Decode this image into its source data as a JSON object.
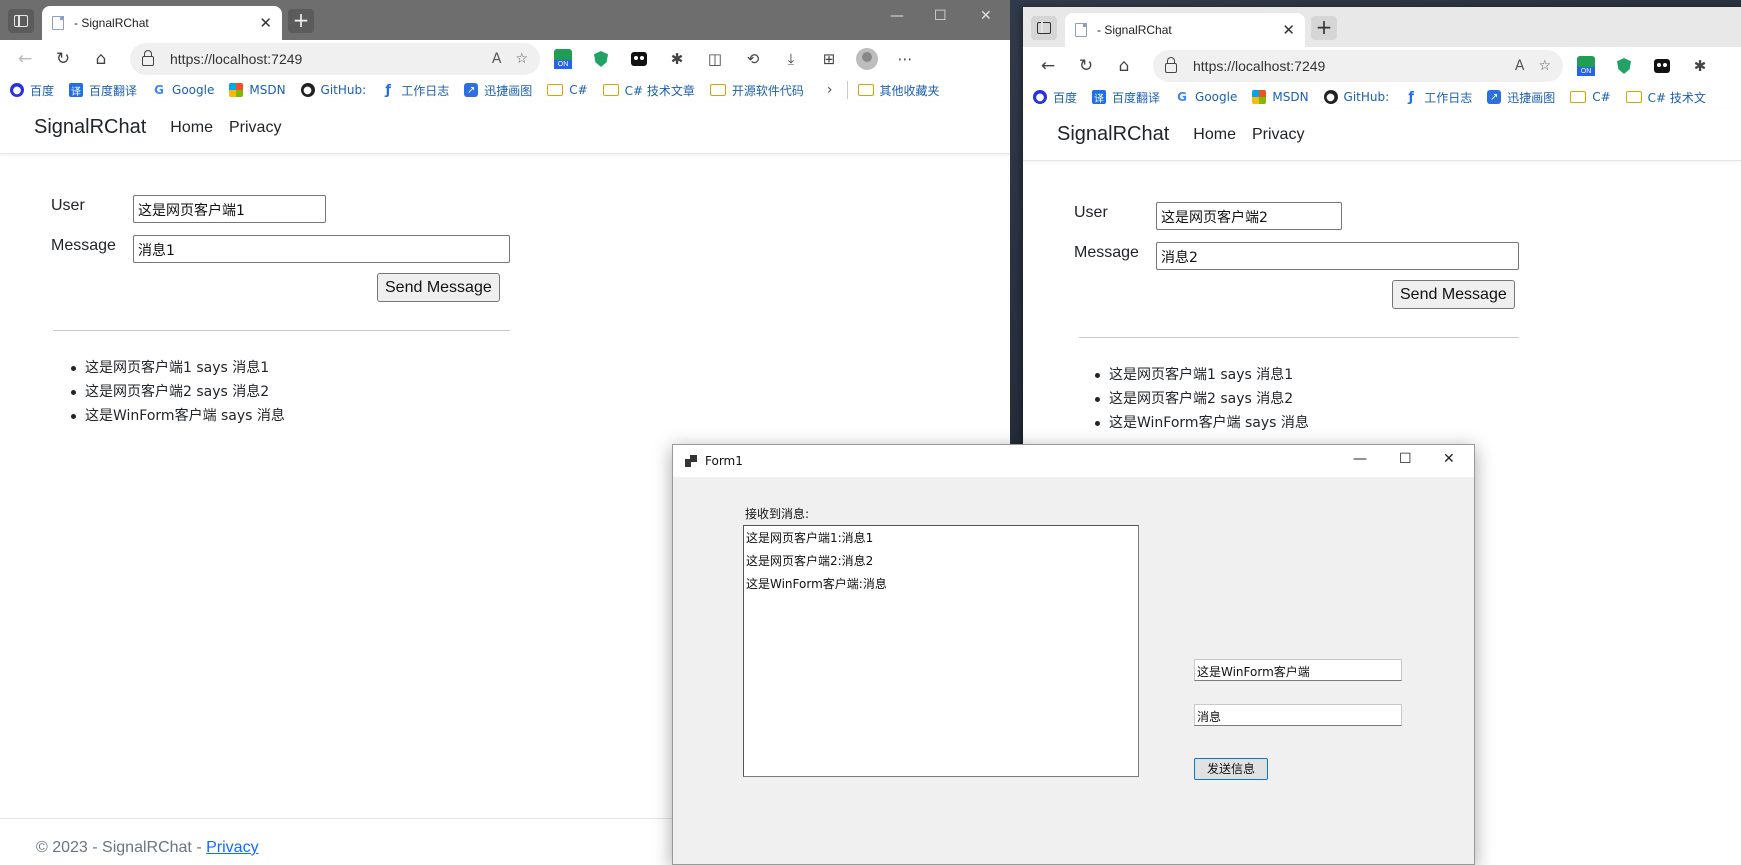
{
  "browser1": {
    "tab_title": "- SignalRChat",
    "url": "https://localhost:7249",
    "favorites": [
      "百度",
      "百度翻译",
      "Google",
      "MSDN",
      "GitHub:",
      "工作日志",
      "迅捷画图",
      "C#",
      "C# 技术文章",
      "开源软件代码",
      "其他收藏夹"
    ],
    "brand": "SignalRChat",
    "nav": [
      "Home",
      "Privacy"
    ],
    "user_label": "User",
    "user_value": "这是网页客户端1",
    "message_label": "Message",
    "message_value": "消息1",
    "send_label": "Send Message",
    "messages": [
      "这是网页客户端1 says 消息1",
      "这是网页客户端2 says 消息2",
      "这是WinForm客户端 says 消息"
    ],
    "footer_text": "© 2023 - SignalRChat -",
    "footer_link": "Privacy"
  },
  "browser2": {
    "tab_title": "- SignalRChat",
    "url": "https://localhost:7249",
    "favorites": [
      "百度",
      "百度翻译",
      "Google",
      "MSDN",
      "GitHub:",
      "工作日志",
      "迅捷画图",
      "C#",
      "C# 技术文"
    ],
    "brand": "SignalRChat",
    "nav": [
      "Home",
      "Privacy"
    ],
    "user_label": "User",
    "user_value": "这是网页客户端2",
    "message_label": "Message",
    "message_value": "消息2",
    "send_label": "Send Message",
    "messages": [
      "这是网页客户端1 says 消息1",
      "这是网页客户端2 says 消息2",
      "这是WinForm客户端 says 消息"
    ]
  },
  "form1": {
    "title": "Form1",
    "received_label": "接收到消息:",
    "received_messages": [
      "这是网页客户端1:消息1",
      "这是网页客户端2:消息2",
      "这是WinForm客户端:消息"
    ],
    "user_value": "这是WinForm客户端",
    "message_value": "消息",
    "send_label": "发送信息"
  },
  "colors": {
    "tabstrip": "#6e6e6e",
    "link": "#0d6efd",
    "winform_bg": "#f0f0f0",
    "winform_button_border": "#0078d7"
  }
}
